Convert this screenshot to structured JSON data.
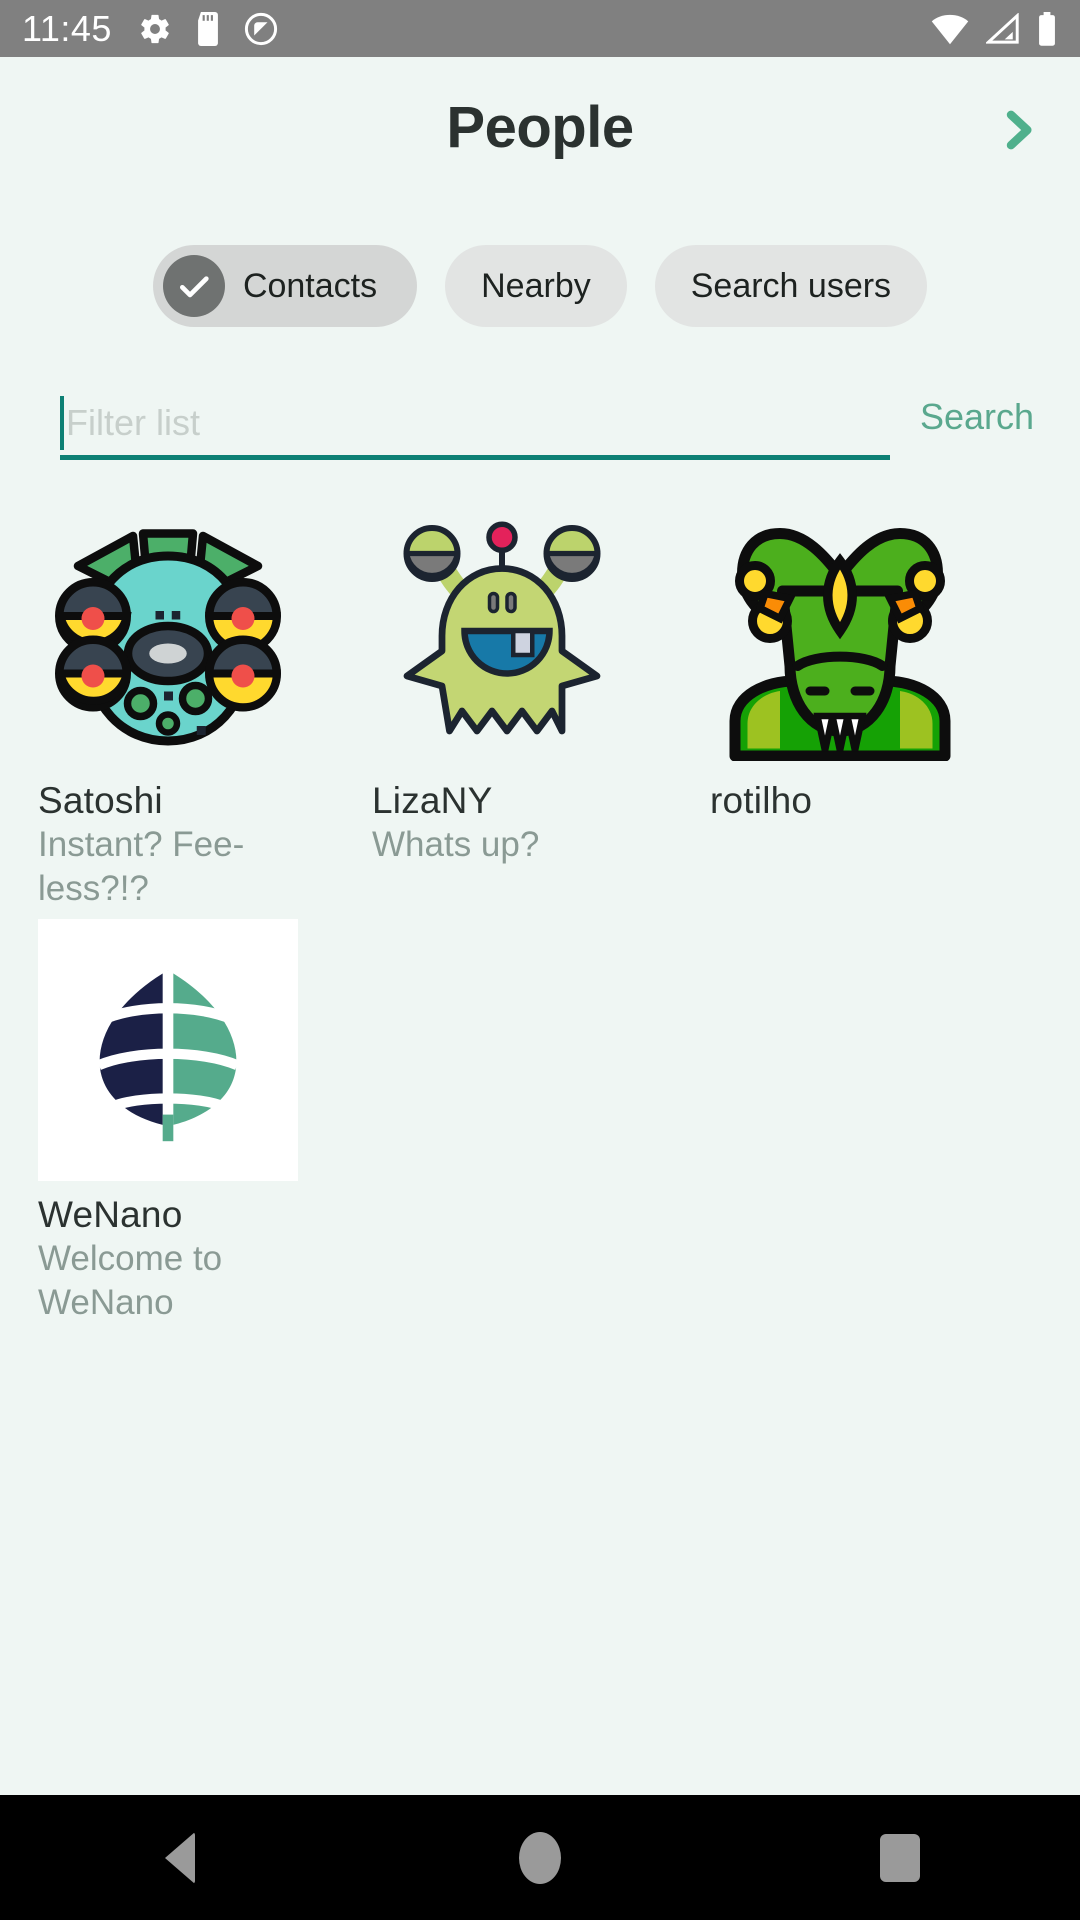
{
  "status_bar": {
    "clock": "11:45",
    "left_icons": [
      "gear-icon",
      "sd-card-icon",
      "do-not-disturb-icon"
    ],
    "right_icons": [
      "wifi-icon",
      "cellular-signal-icon",
      "battery-icon"
    ],
    "background": "#808080",
    "foreground": "#ffffff"
  },
  "header": {
    "title": "People",
    "next_icon": "chevron-right-icon",
    "next_icon_color": "#4fb08c"
  },
  "chips": [
    {
      "label": "Contacts",
      "selected": true,
      "check_icon": "check-icon"
    },
    {
      "label": "Nearby",
      "selected": false
    },
    {
      "label": "Search users",
      "selected": false
    }
  ],
  "filter": {
    "placeholder": "Filter list",
    "value": "",
    "search_label": "Search",
    "underline_color": "#0d8074",
    "search_label_color": "#5aa88e"
  },
  "contacts": [
    {
      "name": "Satoshi",
      "status": "Instant? Fee-less?!?",
      "avatar": "teal-four-eyed-alien-avatar"
    },
    {
      "name": "LizaNY",
      "status": "Whats up?",
      "avatar": "green-stalk-eyed-alien-avatar"
    },
    {
      "name": "rotilho",
      "status": "",
      "avatar": "green-reptile-alien-avatar"
    },
    {
      "name": "WeNano",
      "status": "Welcome to WeNano",
      "avatar": "wenano-globe-leaf-logo"
    }
  ],
  "nav_bar": {
    "back": "back-triangle-icon",
    "home": "home-circle-icon",
    "recents": "recents-square-icon",
    "background": "#000000",
    "icon_color": "#9a9a9a"
  },
  "theme": {
    "page_background": "#eff6f3",
    "accent": "#0d8074",
    "text_primary": "#2b3230",
    "text_secondary": "#8a9a94",
    "chip_background": "#e2e4e3",
    "chip_selected_background": "#d4d6d5"
  }
}
